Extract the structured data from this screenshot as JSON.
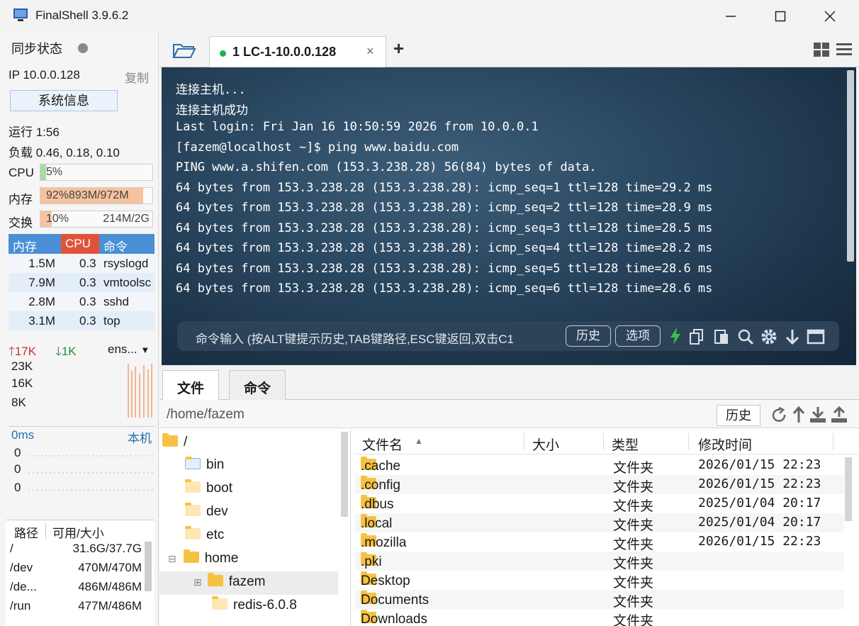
{
  "window": {
    "title": "FinalShell 3.9.6.2"
  },
  "sidebar": {
    "sync_label": "同步状态",
    "ip": "IP 10.0.0.128",
    "copy": "复制",
    "sysinfo_button": "系统信息",
    "uptime": "运行 1:56",
    "load": "负载 0.46, 0.18, 0.10",
    "cpu_label": "CPU",
    "cpu_value": "5%",
    "cpu_fraction": 0.05,
    "mem_label": "内存",
    "mem_value": "92%893M/972M",
    "mem_fraction": 0.92,
    "swap_label": "交换",
    "swap_value": "10%",
    "swap_detail": "214M/2G",
    "swap_fraction": 0.1,
    "proc_headers": [
      "内存",
      "CPU",
      "命令"
    ],
    "processes": [
      {
        "mem": "1.5M",
        "cpu": "0.3",
        "cmd": "rsyslogd"
      },
      {
        "mem": "7.9M",
        "cpu": "0.3",
        "cmd": "vmtoolsc"
      },
      {
        "mem": "2.8M",
        "cpu": "0.3",
        "cmd": "sshd"
      },
      {
        "mem": "3.1M",
        "cpu": "0.3",
        "cmd": "top"
      }
    ],
    "net_up": "17K",
    "net_down": "1K",
    "net_iface": "ens...",
    "net_ticks": [
      "23K",
      "16K",
      "8K"
    ],
    "ping_label": "0ms",
    "ping_host": "本机",
    "ping_ticks": [
      "0",
      "0",
      "0"
    ],
    "disk_headers": [
      "路径",
      "可用/大小"
    ],
    "disks": [
      {
        "path": "/",
        "size": "31.6G/37.7G"
      },
      {
        "path": "/dev",
        "size": "470M/470M"
      },
      {
        "path": "/de...",
        "size": "486M/486M"
      },
      {
        "path": "/run",
        "size": "477M/486M"
      }
    ]
  },
  "tabs": {
    "active": "1 LC-1-10.0.0.128",
    "add": "+"
  },
  "terminal": {
    "lines": [
      "连接主机...",
      "连接主机成功",
      "Last login: Fri Jan 16 10:50:59 2026 from 10.0.0.1",
      "[fazem@localhost ~]$ ping www.baidu.com",
      "PING www.a.shifen.com (153.3.238.28) 56(84) bytes of data.",
      "64 bytes from 153.3.238.28 (153.3.238.28): icmp_seq=1 ttl=128 time=29.2 ms",
      "64 bytes from 153.3.238.28 (153.3.238.28): icmp_seq=2 ttl=128 time=28.9 ms",
      "64 bytes from 153.3.238.28 (153.3.238.28): icmp_seq=3 ttl=128 time=28.5 ms",
      "64 bytes from 153.3.238.28 (153.3.238.28): icmp_seq=4 ttl=128 time=28.2 ms",
      "64 bytes from 153.3.238.28 (153.3.238.28): icmp_seq=5 ttl=128 time=28.6 ms",
      "64 bytes from 153.3.238.28 (153.3.238.28): icmp_seq=6 ttl=128 time=28.6 ms"
    ],
    "cmd_placeholder": "命令输入 (按ALT键提示历史,TAB键路径,ESC键返回,双击C1",
    "history_button": "历史",
    "options_button": "选项"
  },
  "files": {
    "tab_files": "文件",
    "tab_commands": "命令",
    "path": "/home/fazem",
    "history_button": "历史",
    "tree": [
      {
        "name": "/",
        "level": 0
      },
      {
        "name": "bin",
        "level": 1
      },
      {
        "name": "boot",
        "level": 1
      },
      {
        "name": "dev",
        "level": 1
      },
      {
        "name": "etc",
        "level": 1
      },
      {
        "name": "home",
        "level": 1
      },
      {
        "name": "fazem",
        "level": 2
      },
      {
        "name": "redis-6.0.8",
        "level": 2
      }
    ],
    "columns": [
      "文件名",
      "大小",
      "类型",
      "修改时间"
    ],
    "rows": [
      {
        "name": ".cache",
        "size": "",
        "type": "文件夹",
        "mtime": "2026/01/15 22:23"
      },
      {
        "name": ".config",
        "size": "",
        "type": "文件夹",
        "mtime": "2026/01/15 22:23"
      },
      {
        "name": ".dbus",
        "size": "",
        "type": "文件夹",
        "mtime": "2025/01/04 20:17"
      },
      {
        "name": ".local",
        "size": "",
        "type": "文件夹",
        "mtime": "2025/01/04 20:17"
      },
      {
        "name": ".mozilla",
        "size": "",
        "type": "文件夹",
        "mtime": "2026/01/15 22:23"
      },
      {
        "name": ".pki",
        "size": "",
        "type": "文件夹",
        "mtime": ""
      },
      {
        "name": "Desktop",
        "size": "",
        "type": "文件夹",
        "mtime": ""
      },
      {
        "name": "Documents",
        "size": "",
        "type": "文件夹",
        "mtime": ""
      },
      {
        "name": "Downloads",
        "size": "",
        "type": "文件夹",
        "mtime": ""
      }
    ]
  },
  "colors": {
    "accent_blue": "#4a8fd6",
    "cpu_red": "#e0533a",
    "mem_orange": "#f4b48e",
    "green_dot": "#1fb34a"
  }
}
